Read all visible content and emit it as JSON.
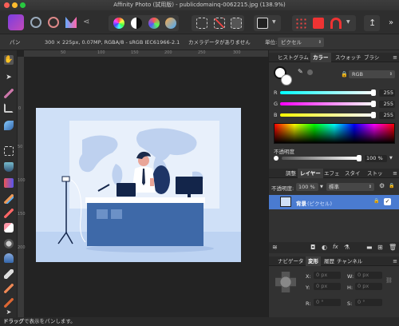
{
  "window": {
    "title": "Affinity Photo (試用版) - publicdomainq-0062215.jpg (138.9%)"
  },
  "context_bar": {
    "mode_label": "パン",
    "image_info": "300 × 225px, 0.07MP, RGBA/8 - sRGB IEC61966-2.1",
    "camera_info": "カメラデータがありません",
    "unit_label": "単位:",
    "unit_value": "ピクセル"
  },
  "rulers": {
    "top": [
      "50",
      "100",
      "150",
      "200",
      "250",
      "300"
    ],
    "left": [
      "0",
      "50",
      "100",
      "150",
      "200"
    ]
  },
  "panels": {
    "color_tabs": [
      "ヒストグラム",
      "カラー",
      "スウォッチ",
      "ブラシ"
    ],
    "color_mode": "RGB",
    "channels": [
      {
        "label": "R",
        "value": "255"
      },
      {
        "label": "G",
        "value": "255"
      },
      {
        "label": "B",
        "value": "255"
      }
    ],
    "opacity_label": "不透明度",
    "opacity_value": "100 %",
    "layer_tabs": [
      "調整",
      "レイヤー",
      "エフェ",
      "スタイ",
      "ストッ"
    ],
    "layer_opacity_label": "不透明度:",
    "layer_opacity_value": "100 %",
    "blend_mode": "標準",
    "layers": [
      {
        "name": "背景",
        "type": "(ピクセル)"
      }
    ],
    "nav_tabs": [
      "ナビゲータ",
      "変形",
      "履歴",
      "チャンネル"
    ],
    "transform": {
      "x_label": "X:",
      "x_value": "0 px",
      "y_label": "Y:",
      "y_value": "0 px",
      "w_label": "W:",
      "w_value": "0 px",
      "h_label": "H:",
      "h_value": "0 px",
      "r_label": "R:",
      "r_value": "0 °",
      "s_label": "S:",
      "s_value": "0 °"
    }
  },
  "status": {
    "bold": "ドラッグ",
    "text": "で表示をパンします。"
  },
  "colors": {
    "accent": "#4a7bd0",
    "doc_bg": "#cfe0f7"
  }
}
